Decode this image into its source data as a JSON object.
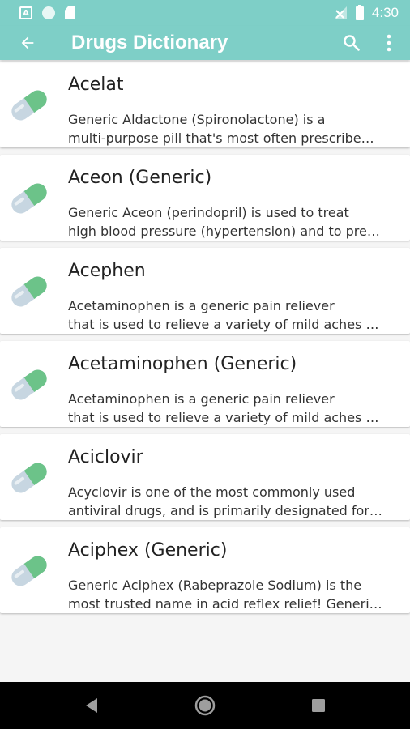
{
  "status_bar": {
    "time": "4:30",
    "notification_icon_letter": "A"
  },
  "app_bar": {
    "title": "Drugs Dictionary",
    "back_icon": "arrow-back-icon",
    "search_icon": "search-icon",
    "more_icon": "more-vert-icon"
  },
  "colors": {
    "primary": "#7ecfc7",
    "pill_green": "#6cc389",
    "pill_grey": "#c7d6e1"
  },
  "drugs": [
    {
      "name": "Acelat",
      "desc_line1": "Generic Aldactone (Spironolactone) is a",
      "desc_line2": "multi-purpose pill that's most often prescribe…"
    },
    {
      "name": "Aceon (Generic)",
      "desc_line1": "Generic Aceon (perindopril) is used to treat",
      "desc_line2": "high blood pressure (hypertension) and to pre…"
    },
    {
      "name": "Acephen",
      "desc_line1": "Acetaminophen is a generic pain reliever",
      "desc_line2": "that is used to relieve a variety of mild aches …"
    },
    {
      "name": "Acetaminophen (Generic)",
      "desc_line1": "Acetaminophen is a generic pain reliever",
      "desc_line2": "that is used to relieve a variety of mild aches …"
    },
    {
      "name": "Aciclovir",
      "desc_line1": "Acyclovir is one of the most commonly used",
      "desc_line2": "antiviral drugs, and is primarily designated for…"
    },
    {
      "name": "Aciphex (Generic)",
      "desc_line1": "Generic Aciphex (Rabeprazole Sodium) is the",
      "desc_line2": "most trusted name in acid reflex relief! Generi…"
    }
  ],
  "nav_bar": {
    "back_icon": "nav-back-icon",
    "home_icon": "nav-home-icon",
    "recents_icon": "nav-recents-icon"
  }
}
